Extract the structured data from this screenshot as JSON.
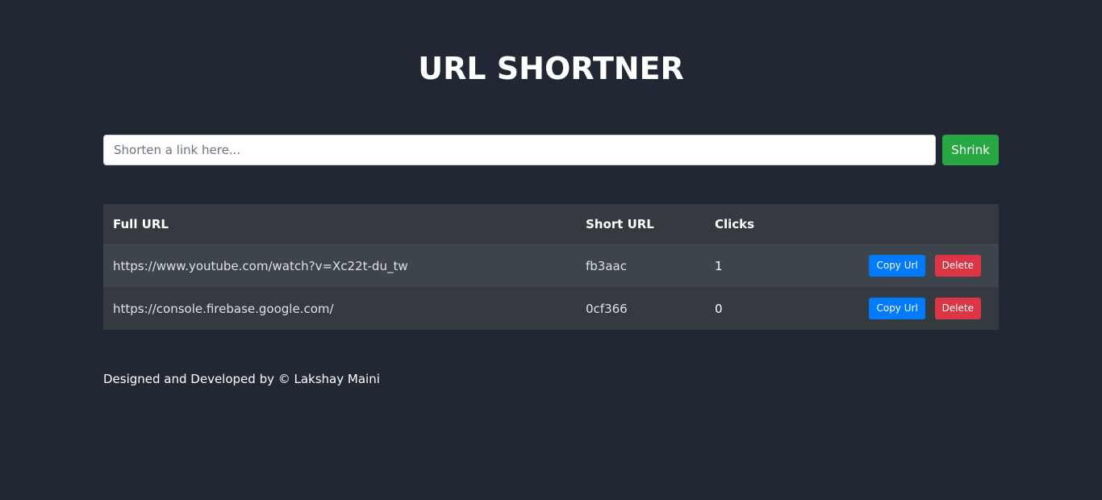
{
  "header": {
    "title": "URL SHORTNER"
  },
  "form": {
    "placeholder": "Shorten a link here...",
    "value": "",
    "submit_label": "Shrink"
  },
  "table": {
    "columns": [
      "Full URL",
      "Short URL",
      "Clicks",
      ""
    ],
    "rows": [
      {
        "full_url": "https://www.youtube.com/watch?v=Xc22t-du_tw",
        "short_url": "fb3aac",
        "clicks": "1",
        "copy_label": "Copy Url",
        "delete_label": "Delete"
      },
      {
        "full_url": "https://console.firebase.google.com/",
        "short_url": "0cf366",
        "clicks": "0",
        "copy_label": "Copy Url",
        "delete_label": "Delete"
      }
    ]
  },
  "footer": {
    "text": "Designed and Developed by © Lakshay Maini"
  },
  "colors": {
    "background": "#222833",
    "shrink_button": "#28a745",
    "copy_button": "#007bff",
    "delete_button": "#dc3545",
    "table_header": "#343a40"
  }
}
